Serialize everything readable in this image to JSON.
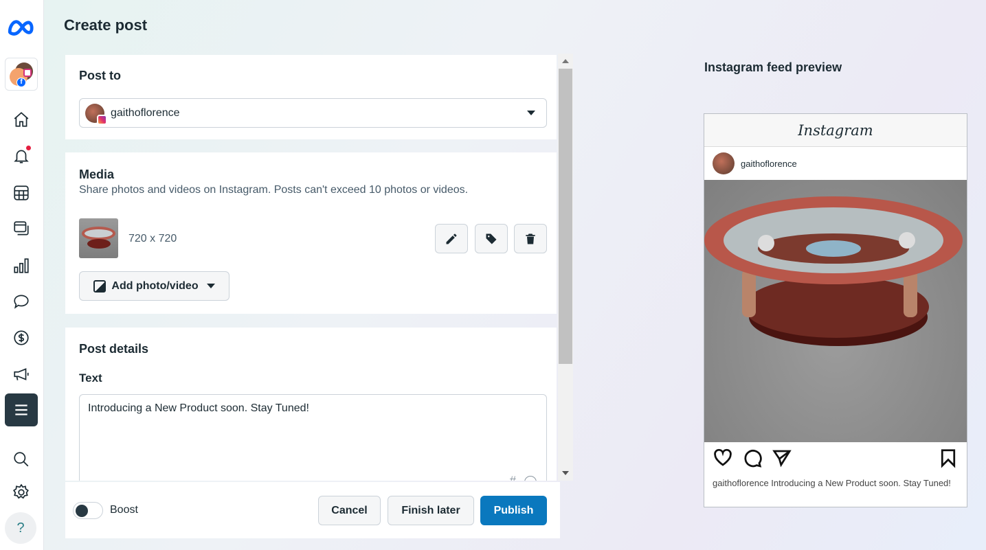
{
  "page": {
    "title": "Create post"
  },
  "sidebar": {
    "items": [
      "meta-logo",
      "account-switcher",
      "home",
      "notifications",
      "planner",
      "content",
      "insights",
      "inbox",
      "monetization",
      "ads",
      "all-tools",
      "search",
      "settings",
      "help"
    ],
    "notification_dot_color": "#e41e3f"
  },
  "post_to": {
    "heading": "Post to",
    "account": "gaithoflorence"
  },
  "media": {
    "heading": "Media",
    "description": "Share photos and videos on Instagram. Posts can't exceed 10 photos or videos.",
    "item_dimensions": "720 x 720",
    "add_label": "Add photo/video"
  },
  "details": {
    "heading": "Post details",
    "text_label": "Text",
    "text_value": "Introducing a New Product soon. Stay Tuned!",
    "hashtag_symbol": "#"
  },
  "footer": {
    "boost_label": "Boost",
    "boost_on": false,
    "cancel": "Cancel",
    "finish_later": "Finish later",
    "publish": "Publish",
    "publish_color": "#0a78be"
  },
  "preview": {
    "label": "Instagram feed preview",
    "brand": "Instagram",
    "username": "gaithoflorence",
    "caption_user": "gaithoflorence",
    "caption_text": "Introducing a New Product soon. Stay Tuned!"
  }
}
